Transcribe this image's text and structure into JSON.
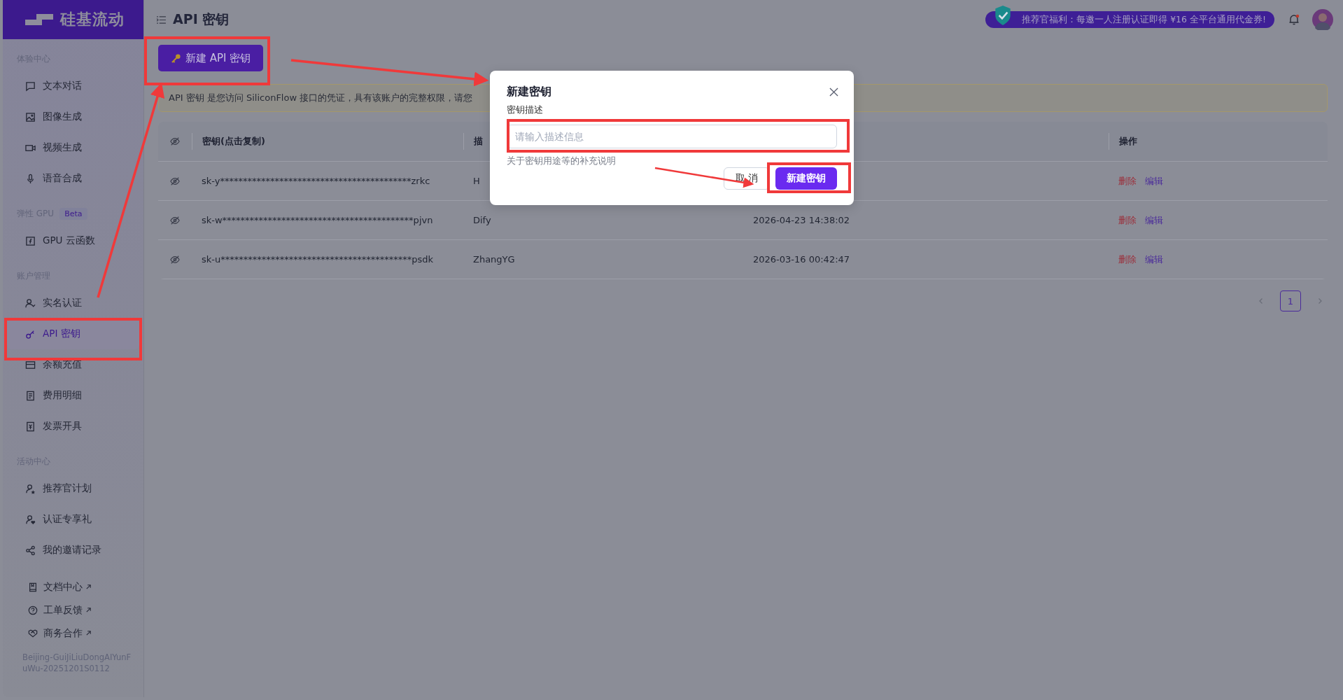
{
  "sidebar": {
    "logo": "硅基流动",
    "sections": [
      {
        "title": "体验中心",
        "items": [
          {
            "label": "文本对话",
            "selected": false
          },
          {
            "label": "图像生成",
            "selected": false
          },
          {
            "label": "视频生成",
            "selected": false
          },
          {
            "label": "语音合成",
            "selected": false
          }
        ]
      },
      {
        "title": "弹性 GPU",
        "badge": "Beta",
        "items": [
          {
            "label": "GPU 云函数",
            "selected": false
          }
        ]
      },
      {
        "title": "账户管理",
        "items": [
          {
            "label": "实名认证",
            "selected": false
          },
          {
            "label": "API 密钥",
            "selected": true
          },
          {
            "label": "余额充值",
            "selected": false
          },
          {
            "label": "费用明细",
            "selected": false
          },
          {
            "label": "发票开具",
            "selected": false
          }
        ]
      },
      {
        "title": "活动中心",
        "items": [
          {
            "label": "推荐官计划",
            "selected": false
          },
          {
            "label": "认证专享礼",
            "selected": false
          },
          {
            "label": "我的邀请记录",
            "selected": false
          }
        ]
      }
    ],
    "links": [
      "文档中心",
      "工单反馈",
      "商务合作"
    ],
    "footer": "Beijing-GuiJiLiuDongAIYunFuWu-20251201S0112"
  },
  "header": {
    "title": "API 密钥",
    "promo": "推荐官福利：每邀一人注册认证即得 ¥16 全平台通用代金券!"
  },
  "new_button": "新建 API 密钥",
  "notice": "API 密钥 是您访问 SiliconFlow 接口的凭证，具有该账户的完整权限，请您",
  "table": {
    "columns": [
      "密钥(点击复制)",
      "描",
      "操作"
    ],
    "rows": [
      {
        "key": "sk-y******************************************zrkc",
        "description": "H",
        "actions": [
          {
            "label": "删除",
            "kind": "danger"
          },
          {
            "label": "编辑",
            "kind": "edit"
          }
        ]
      },
      {
        "key": "sk-w******************************************pjvn",
        "description": "Dify",
        "created": "2026-04-23 14:38:02",
        "actions": [
          {
            "label": "删除",
            "kind": "danger"
          },
          {
            "label": "编辑",
            "kind": "edit"
          }
        ]
      },
      {
        "key": "sk-u******************************************psdk",
        "description": "ZhangYG",
        "created": "2026-03-16 00:42:47",
        "actions": [
          {
            "label": "删除",
            "kind": "danger"
          },
          {
            "label": "编辑",
            "kind": "edit"
          }
        ]
      }
    ]
  },
  "pagination": [
    {
      "label": "1",
      "selected": true
    }
  ],
  "dialog": {
    "title": "新建密钥",
    "field_label": "密钥描述",
    "placeholder": "请输入描述信息",
    "help": "关于密钥用途等的补充说明",
    "cancel": "取 消",
    "confirm": "新建密钥"
  }
}
